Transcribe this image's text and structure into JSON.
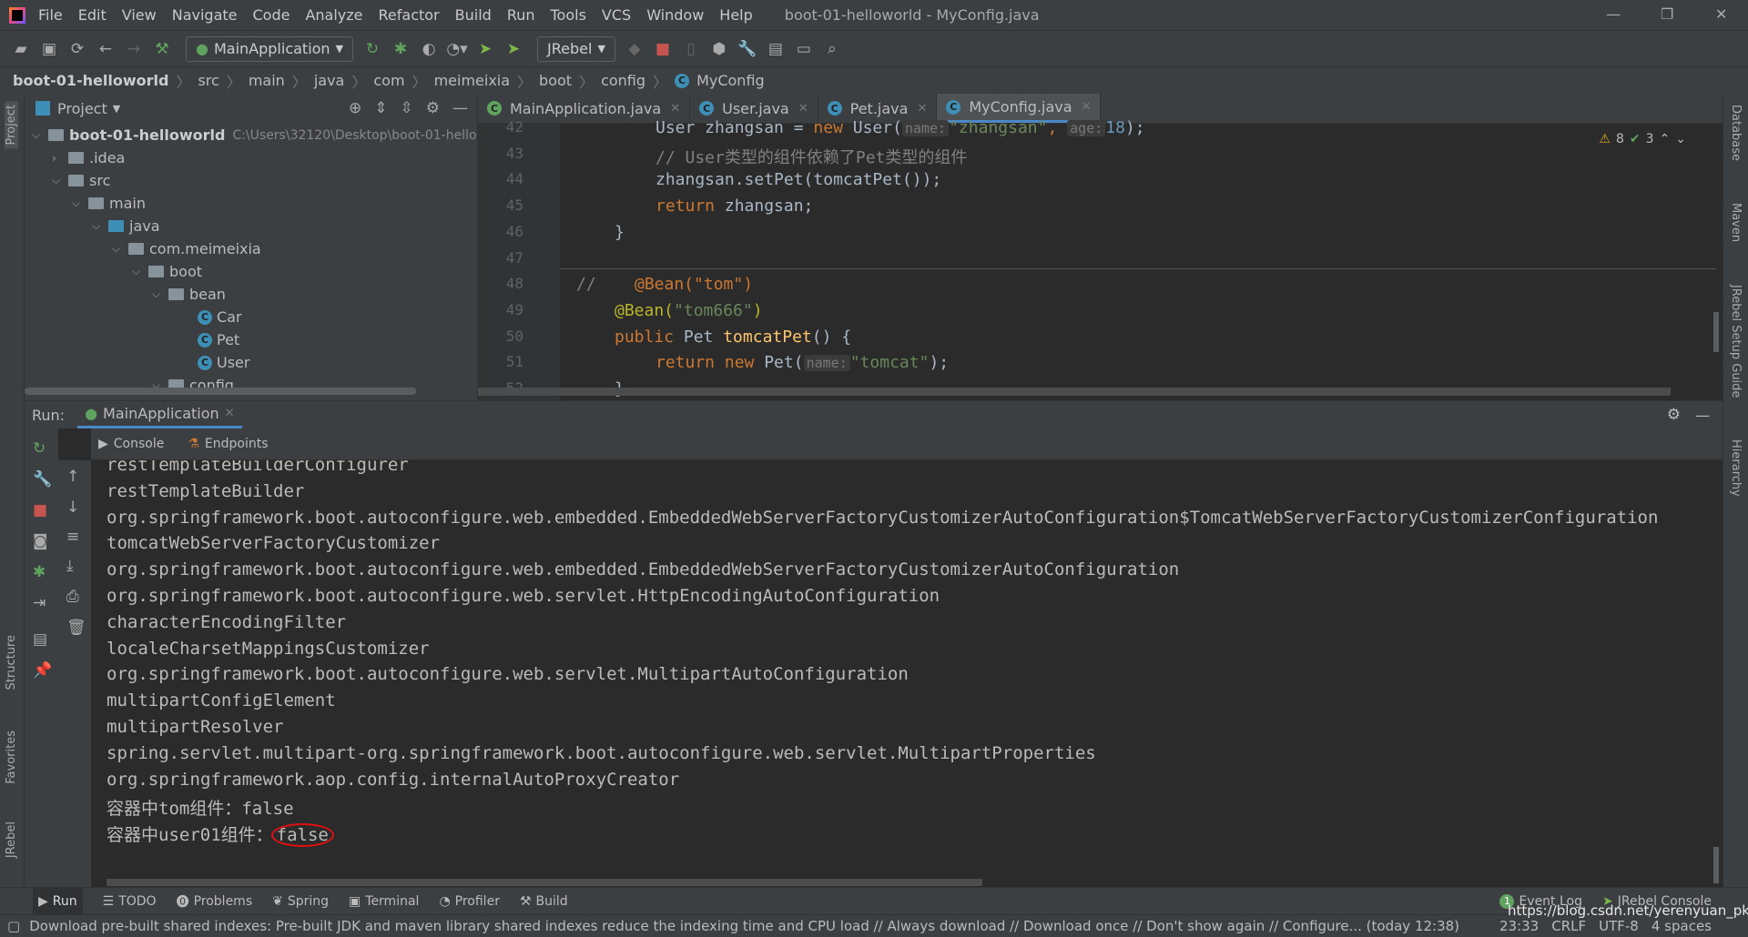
{
  "menu": {
    "items": [
      "File",
      "Edit",
      "View",
      "Navigate",
      "Code",
      "Analyze",
      "Refactor",
      "Build",
      "Run",
      "Tools",
      "VCS",
      "Window",
      "Help"
    ],
    "title": "boot-01-helloworld - MyConfig.java"
  },
  "toolbar": {
    "run_config": "MainApplication",
    "jrebel": "JRebel"
  },
  "breadcrumb": [
    "boot-01-helloworld",
    "src",
    "main",
    "java",
    "com",
    "meimeixia",
    "boot",
    "config",
    "MyConfig"
  ],
  "project": {
    "title": "Project",
    "root": "boot-01-helloworld",
    "root_path": "C:\\Users\\32120\\Desktop\\boot-01-hello",
    "nodes": [
      ".idea",
      "src",
      "main",
      "java",
      "com.meimeixia",
      "boot",
      "bean",
      "Car",
      "Pet",
      "User",
      "config"
    ]
  },
  "tabs": [
    {
      "label": "MainApplication.java"
    },
    {
      "label": "User.java"
    },
    {
      "label": "Pet.java"
    },
    {
      "label": "MyConfig.java",
      "active": true
    }
  ],
  "inspections": {
    "warnings": "8",
    "weak": "3"
  },
  "code": {
    "line_numbers": [
      "42",
      "43",
      "44",
      "45",
      "46",
      "47",
      "48",
      "49",
      "50",
      "51",
      "52"
    ],
    "l42a": "User zhangsan = ",
    "l42kw": "new ",
    "l42b": "User(",
    "l42h1": "name:",
    "l42s": "\"zhangsan\"",
    ",": ", ",
    "l42h2": "age:",
    "l42n": "18",
    "l42e": ");",
    "l43": "// User类型的组件依赖了Pet类型的组件",
    "l44": "zhangsan.setPet(tomcatPet());",
    "l45kw": "return ",
    "l45": "zhangsan;",
    "l46": "}",
    "l48c": "//",
    "l48": "@Bean(\"tom\")",
    "l49a": "@Bean(",
    "l49s": "\"tom666\"",
    "l49e": ")",
    "l50kw": "public ",
    "l50a": "Pet ",
    "l50fn": "tomcatPet",
    "l50b": "() {",
    "l51kw": "return new ",
    "l51a": "Pet(",
    "l51h": "name:",
    "l51s": "\"tomcat\"",
    "l51e": ");",
    "l52": "}"
  },
  "run": {
    "label": "Run:",
    "config": "MainApplication",
    "console_tab": "Console",
    "endpoints_tab": "Endpoints",
    "lines": [
      "restTemplateBuilderConfigurer",
      "restTemplateBuilder",
      "org.springframework.boot.autoconfigure.web.embedded.EmbeddedWebServerFactoryCustomizerAutoConfiguration$TomcatWebServerFactoryCustomizerConfiguration",
      "tomcatWebServerFactoryCustomizer",
      "org.springframework.boot.autoconfigure.web.embedded.EmbeddedWebServerFactoryCustomizerAutoConfiguration",
      "org.springframework.boot.autoconfigure.web.servlet.HttpEncodingAutoConfiguration",
      "characterEncodingFilter",
      "localeCharsetMappingsCustomizer",
      "org.springframework.boot.autoconfigure.web.servlet.MultipartAutoConfiguration",
      "multipartConfigElement",
      "multipartResolver",
      "spring.servlet.multipart-org.springframework.boot.autoconfigure.web.servlet.MultipartProperties",
      "org.springframework.aop.config.internalAutoProxyCreator",
      "容器中tom组件：false"
    ],
    "last_prefix": "容器中user01组件：",
    "last_value": "false",
    "highlight_color": "#e01010"
  },
  "bottom_tools": [
    "Run",
    "TODO",
    "Problems",
    "Spring",
    "Terminal",
    "Profiler",
    "Build"
  ],
  "bottom_right": {
    "event_log": "Event Log",
    "event_count": "1",
    "jrebel_console": "JRebel Console"
  },
  "left_strip": [
    "Project",
    "Structure",
    "Favorites",
    "JRebel"
  ],
  "right_strip": [
    "Database",
    "Maven",
    "JRebel Setup Guide",
    "Hierarchy"
  ],
  "status": {
    "message": "Download pre-built shared indexes: Pre-built JDK and maven library shared indexes reduce the indexing time and CPU load // Always download // Download once // Don't show again // Configure... (today 12:38)",
    "position": "23:33",
    "line_sep": "CRLF",
    "encoding": "UTF-8",
    "indent": "4 spaces",
    "watermark": "https://blog.csdn.net/yerenyuan_pku"
  }
}
